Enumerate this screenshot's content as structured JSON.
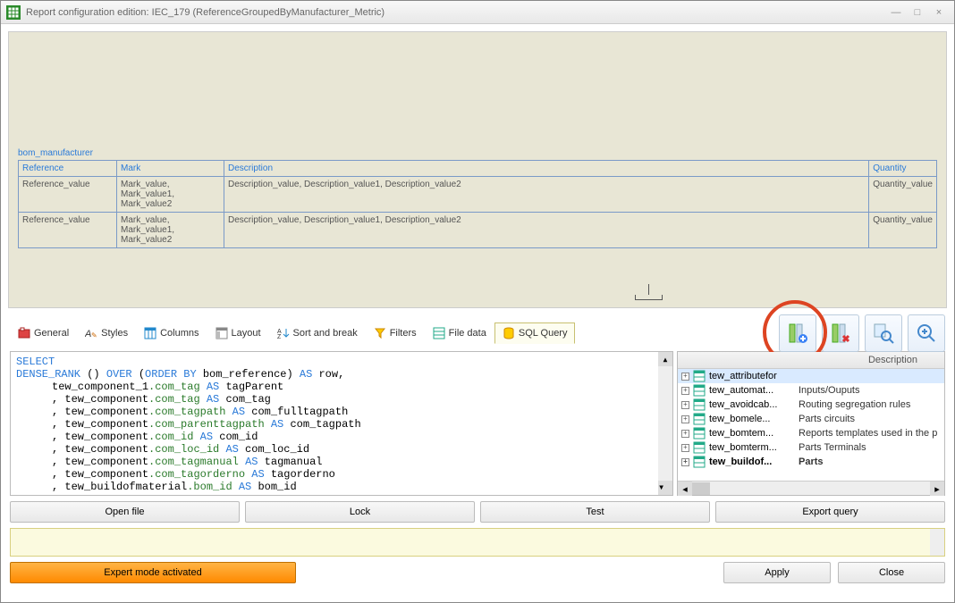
{
  "window": {
    "title": "Report configuration edition: IEC_179 (ReferenceGroupedByManufacturer_Metric)"
  },
  "preview": {
    "group_title": "bom_manufacturer",
    "headers": {
      "reference": "Reference",
      "mark": "Mark",
      "description": "Description",
      "quantity": "Quantity"
    },
    "row": {
      "reference": "Reference_value",
      "mark": "Mark_value, Mark_value1, Mark_value2",
      "description": "Description_value, Description_value1, Description_value2",
      "quantity": "Quantity_value"
    }
  },
  "tabs": {
    "general": "General",
    "styles": "Styles",
    "columns": "Columns",
    "layout": "Layout",
    "sort": "Sort and break",
    "filters": "Filters",
    "filedata": "File data",
    "sql": "SQL Query"
  },
  "sql": {
    "l1a": "SELECT",
    "l2a": "DENSE_RANK",
    "l2b": " () ",
    "l2c": "OVER",
    "l2d": " (",
    "l2e": "ORDER BY",
    "l2f": " bom_reference) ",
    "l2g": "AS",
    "l2h": " row,",
    "l3a": "tew_component_1",
    "l3b": ".com_tag ",
    "l3c": "AS",
    "l3d": " tagParent",
    "l4a": ", tew_component",
    "l4b": ".com_tag ",
    "l4c": "AS",
    "l4d": " com_tag",
    "l5a": ", tew_component",
    "l5b": ".com_tagpath ",
    "l5c": "AS",
    "l5d": " com_fulltagpath",
    "l6a": ", tew_component",
    "l6b": ".com_parenttagpath ",
    "l6c": "AS",
    "l6d": " com_tagpath",
    "l7a": ", tew_component",
    "l7b": ".com_id ",
    "l7c": "AS",
    "l7d": " com_id",
    "l8a": ", tew_component",
    "l8b": ".com_loc_id ",
    "l8c": "AS",
    "l8d": " com_loc_id",
    "l9a": ", tew_component",
    "l9b": ".com_tagmanual ",
    "l9c": "AS",
    "l9d": " tagmanual",
    "l10a": ", tew_component",
    "l10b": ".com_tagorderno ",
    "l10c": "AS",
    "l10d": " tagorderno",
    "l11a": ", tew_buildofmaterial",
    "l11b": ".bom_id ",
    "l11c": "AS",
    "l11d": " bom_id"
  },
  "side": {
    "header": "Description",
    "items": [
      {
        "name": "tew_attributefor",
        "desc": ""
      },
      {
        "name": "tew_automat...",
        "desc": "Inputs/Ouputs"
      },
      {
        "name": "tew_avoidcab...",
        "desc": "Routing segregation rules"
      },
      {
        "name": "tew_bomele...",
        "desc": "Parts circuits"
      },
      {
        "name": "tew_bomtem...",
        "desc": "Reports templates used in the p"
      },
      {
        "name": "tew_bomterm...",
        "desc": "Parts Terminals"
      },
      {
        "name": "tew_buildof...",
        "desc": "Parts"
      }
    ]
  },
  "buttons": {
    "open": "Open file",
    "lock": "Lock",
    "test": "Test",
    "export": "Export query",
    "expert": "Expert mode activated",
    "apply": "Apply",
    "close": "Close"
  }
}
